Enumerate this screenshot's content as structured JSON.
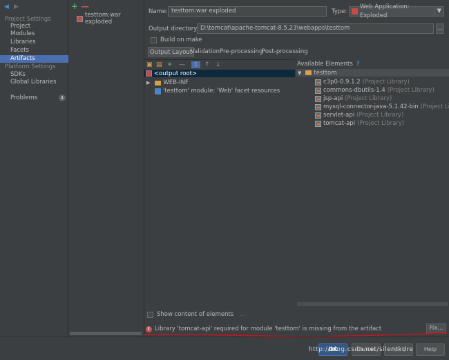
{
  "nav": {
    "back_icon": "arrow-left-icon",
    "forward_icon": "arrow-right-icon",
    "project_settings": "Project Settings",
    "items_project": [
      "Project",
      "Modules",
      "Libraries",
      "Facets",
      "Artifacts"
    ],
    "selected": "Artifacts",
    "platform_settings": "Platform Settings",
    "items_platform": [
      "SDKs",
      "Global Libraries"
    ],
    "problems": "Problems",
    "problems_count": "4"
  },
  "artifacts": {
    "add_icon": "plus-icon",
    "remove_icon": "minus-icon",
    "items": [
      "testtom:war exploded"
    ]
  },
  "form": {
    "name_label": "Name:",
    "name_value": "testtom:war exploded",
    "type_label": "Type:",
    "type_value": "Web Application: Exploded",
    "output_label": "Output directory:",
    "output_value": "D:\\tomcat\\apache-tomcat-8.5.23\\webapps\\testtom",
    "build_label": "Build on make"
  },
  "tabs": [
    "Output Layout",
    "Validation",
    "Pre-processing",
    "Post-processing"
  ],
  "layout_tree": {
    "root": "<output root>",
    "web_inf": "WEB-INF",
    "module_resources": "'testtom' module: 'Web' facet resources"
  },
  "available": {
    "header": "Available Elements",
    "help": "?",
    "root": "testtom",
    "libraries": [
      {
        "name": "c3p0-0.9.1.2",
        "suffix": "(Project Library)"
      },
      {
        "name": "commons-dbutils-1.4",
        "suffix": "(Project Library)"
      },
      {
        "name": "jsp-api",
        "suffix": "(Project Library)"
      },
      {
        "name": "mysql-connector-java-5.1.42-bin",
        "suffix": "(Project Library)"
      },
      {
        "name": "servlet-api",
        "suffix": "(Project Library)"
      },
      {
        "name": "tomcat-api",
        "suffix": "(Project Library)"
      }
    ]
  },
  "show_content": "Show content of elements",
  "error": {
    "message": "Library 'tomcat-api' required for module 'testtom' is missing from the artifact",
    "fix": "Fix..."
  },
  "buttons": {
    "ok": "OK",
    "cancel": "Cancel",
    "apply": "Apply",
    "help": "Help"
  },
  "watermark": "http://blog.csdn.net/silentkdre",
  "colors": {
    "selection": "#4b6eaf",
    "error": "#c75450",
    "annotation": "#c0161d"
  }
}
